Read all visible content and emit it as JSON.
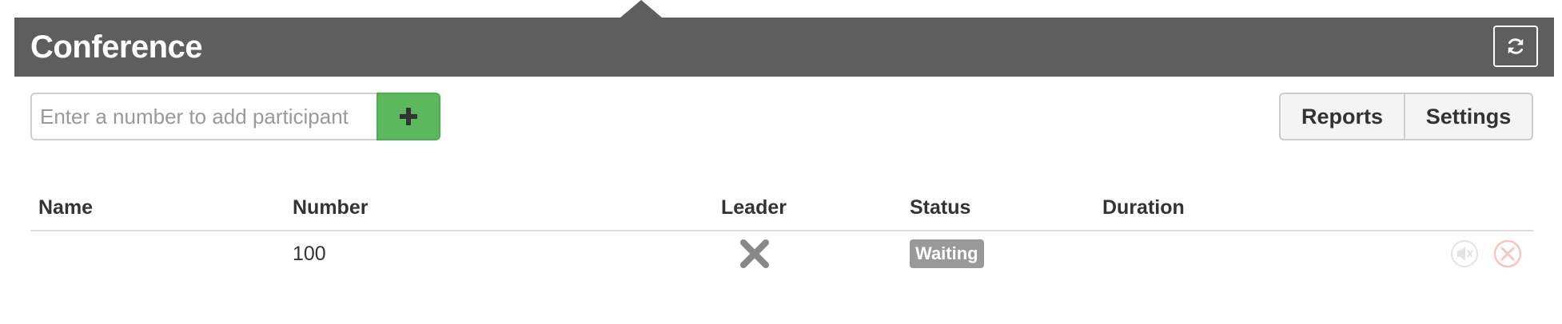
{
  "header": {
    "title": "Conference",
    "refresh_icon": "refresh-icon"
  },
  "add_participant": {
    "placeholder": "Enter a number to add participant",
    "value": "",
    "button_icon": "plus-icon",
    "button_color": "#5cb85c"
  },
  "actions": {
    "reports_label": "Reports",
    "settings_label": "Settings"
  },
  "table": {
    "columns": [
      "Name",
      "Number",
      "Leader",
      "Status",
      "Duration"
    ],
    "rows": [
      {
        "name": "",
        "number": "100",
        "leader_icon": "x-icon",
        "status": "Waiting",
        "duration": "",
        "mute_icon": "speaker-mute-icon",
        "kick_icon": "remove-circle-icon"
      }
    ]
  },
  "colors": {
    "header_bg": "#5e5e5e",
    "badge_bg": "#999999",
    "success": "#5cb85c"
  }
}
